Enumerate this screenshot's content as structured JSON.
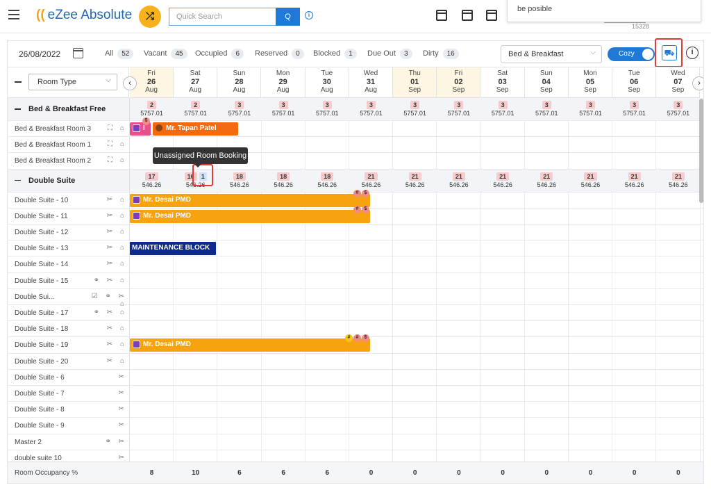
{
  "app": {
    "name": "eZee Absolute",
    "logo_mark": "((",
    "search_placeholder": "Quick Search",
    "search_icon_label": "Q"
  },
  "popup": {
    "text": "be posible",
    "sub": "15328"
  },
  "toolbar": {
    "date": "26/08/2022",
    "stats": [
      {
        "label": "All",
        "count": "52"
      },
      {
        "label": "Vacant",
        "count": "45"
      },
      {
        "label": "Occupied",
        "count": "6"
      },
      {
        "label": "Reserved",
        "count": "0"
      },
      {
        "label": "Blocked",
        "count": "1"
      },
      {
        "label": "Due Out",
        "count": "3"
      },
      {
        "label": "Dirty",
        "count": "16"
      }
    ],
    "rate_plan": "Bed & Breakfast",
    "toggle_label": "Cozy"
  },
  "grid": {
    "room_type_select": "Room Type",
    "dates": [
      {
        "dow": "Fri",
        "day": "26",
        "mon": "Aug"
      },
      {
        "dow": "Sat",
        "day": "27",
        "mon": "Aug"
      },
      {
        "dow": "Sun",
        "day": "28",
        "mon": "Aug"
      },
      {
        "dow": "Mon",
        "day": "29",
        "mon": "Aug"
      },
      {
        "dow": "Tue",
        "day": "30",
        "mon": "Aug"
      },
      {
        "dow": "Wed",
        "day": "31",
        "mon": "Aug"
      },
      {
        "dow": "Thu",
        "day": "01",
        "mon": "Sep"
      },
      {
        "dow": "Fri",
        "day": "02",
        "mon": "Sep"
      },
      {
        "dow": "Sat",
        "day": "03",
        "mon": "Sep"
      },
      {
        "dow": "Sun",
        "day": "04",
        "mon": "Sep"
      },
      {
        "dow": "Mon",
        "day": "05",
        "mon": "Sep"
      },
      {
        "dow": "Tue",
        "day": "06",
        "mon": "Sep"
      },
      {
        "dow": "Wed",
        "day": "07",
        "mon": "Sep"
      }
    ],
    "categories": [
      {
        "name": "Bed & Breakfast Free",
        "avail": [
          "2",
          "2",
          "3",
          "3",
          "3",
          "3",
          "3",
          "3",
          "3",
          "3",
          "3",
          "3",
          "3"
        ],
        "rates": [
          "5757.01",
          "5757.01",
          "5757.01",
          "5757.01",
          "5757.01",
          "5757.01",
          "5757.01",
          "5757.01",
          "5757.01",
          "5757.01",
          "5757.01",
          "5757.01",
          "5757.01"
        ]
      },
      {
        "name": "Double Suite",
        "avail": [
          "17",
          "16",
          "18",
          "18",
          "18",
          "21",
          "21",
          "21",
          "21",
          "21",
          "21",
          "21",
          "21"
        ],
        "rates": [
          "546.26",
          "546.26",
          "546.26",
          "546.26",
          "546.26",
          "546.26",
          "546.26",
          "546.26",
          "546.26",
          "546.26",
          "546.26",
          "546.26",
          "546.26"
        ],
        "unassigned": "1"
      }
    ],
    "rooms_bb": [
      "Bed & Breakfast Room 3",
      "Bed & Breakfast Room 1",
      "Bed & Breakfast Room 2"
    ],
    "rooms_ds": [
      "Double Suite - 10",
      "Double Suite - 11",
      "Double Suite - 12",
      "Double Suite - 13",
      "Double Suite - 14",
      "Double Suite - 15",
      "Double Sui...",
      "Double Suite - 17",
      "Double Suite - 18",
      "Double Suite - 19",
      "Double Suite - 20",
      "Double Suite - 6",
      "Double Suite - 7",
      "Double Suite - 8",
      "Double Suite - 9",
      "Master 2",
      "double suite 10"
    ],
    "bookings": {
      "tapan": "Mr. Tapan Patel",
      "tapan_prefix": "I",
      "desai": "Mr. Desai PMD",
      "maintenance": "MAINTENANCE BLOCK"
    },
    "tooltip": "Unassigned Room Booking",
    "occupancy_label": "Room Occupancy %",
    "occupancy": [
      "8",
      "10",
      "6",
      "6",
      "6",
      "0",
      "0",
      "0",
      "0",
      "0",
      "0",
      "0",
      "0"
    ]
  },
  "colors": {
    "accent": "#1e7ad6",
    "booking": "#f7a20f",
    "maintenance": "#0d2a8a",
    "alert": "#e53935"
  }
}
